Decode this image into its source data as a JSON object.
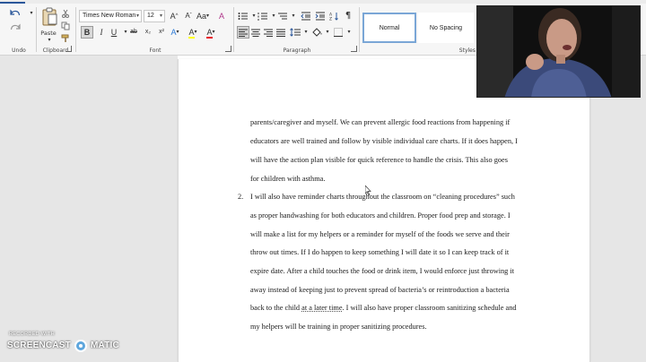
{
  "ribbon": {
    "undo_group_label": "Undo",
    "clipboard": {
      "group_label": "Clipboard",
      "paste_label": "Paste"
    },
    "font": {
      "group_label": "Font",
      "font_name": "Times New Roman",
      "font_size": "12",
      "bold": "B",
      "italic": "I",
      "underline": "U",
      "strikethrough": "ab",
      "subscript": "x₂",
      "superscript": "x²",
      "grow": "A",
      "shrink": "A",
      "case": "Aa",
      "clear": "A",
      "effects": "A",
      "highlight": "A",
      "color": "A",
      "highlight_color": "#ffff00",
      "font_color": "#e81123"
    },
    "paragraph": {
      "group_label": "Paragraph",
      "pilcrow": "¶"
    },
    "styles": {
      "group_label": "Styles",
      "items": [
        "Normal",
        "No Spacing"
      ]
    }
  },
  "document": {
    "lines": [
      "parents/caregiver and myself. We can prevent allergic food reactions from happening if",
      "educators are well trained and follow by visible individual care charts. If it does happen, I",
      "will have the action plan visible for quick reference to handle the crisis. This also goes",
      "for children with asthma."
    ],
    "item2_number": "2.",
    "item2_lines": [
      "I will also have reminder charts throughout the classroom on “cleaning procedures” such",
      "as proper handwashing for both educators and children. Proper food prep and storage. I",
      "will make a list for my helpers or a reminder for myself of the foods we serve and their",
      "throw out times. If I do happen to keep something I will date it so I can keep track of it",
      "expire date. After a child touches the food or drink item, I would enforce just throwing it",
      "away instead of keeping just to prevent spread of bacteria’s or reintroduction a bacteria"
    ],
    "line_back_pre": "back to the child ",
    "line_back_ul": "at a later time",
    "line_back_post": ". I will also have proper classroom sanitizing schedule and",
    "last_line": "my helpers will be training in proper sanitizing procedures."
  },
  "watermark": {
    "small": "RECORDED WITH",
    "big_left": "SCREENCAST",
    "big_right": "MATIC"
  },
  "colors": {
    "accent": "#2b579a",
    "watermark_logo": "#5ea6dd"
  }
}
